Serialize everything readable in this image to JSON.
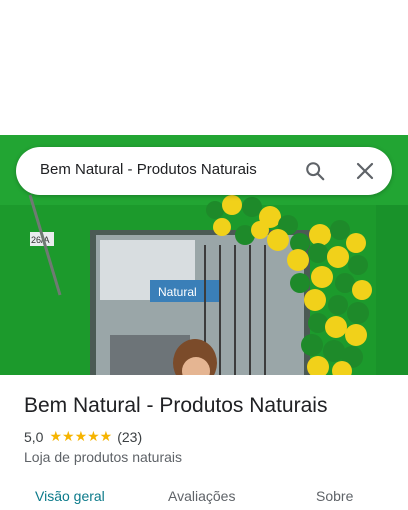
{
  "search": {
    "query": "Bem Natural - Produtos Naturais"
  },
  "hero": {
    "storefront_number": "26/A",
    "shop_sign": "Natural"
  },
  "place": {
    "name": "Bem Natural - Produtos Naturais",
    "rating": "5,0",
    "stars": "★★★★★",
    "review_count": "(23)",
    "category": "Loja de produtos naturais"
  },
  "tabs": [
    {
      "label": "Visão geral",
      "active": true
    },
    {
      "label": "Avaliações",
      "active": false
    },
    {
      "label": "Sobre",
      "active": false
    }
  ],
  "colors": {
    "accent": "#0b7a8a",
    "star": "#f6b400",
    "storefront_green": "#1f9a2e"
  }
}
